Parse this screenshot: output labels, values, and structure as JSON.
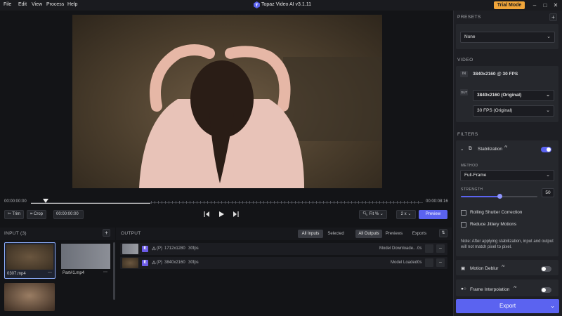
{
  "menu": [
    "File",
    "Edit",
    "View",
    "Process",
    "Help"
  ],
  "app": {
    "title": "Topaz Video AI  v3.1.11",
    "trial_label": "Trial Mode"
  },
  "timeline": {
    "start": "00:00:00:00",
    "end": "00:00:08:16",
    "time_field": "00:00:00:00"
  },
  "toolbar": {
    "trim": "Trim",
    "crop": "Crop",
    "fit": "Fit %",
    "speed": "2 x",
    "preview": "Preview"
  },
  "input": {
    "header": "INPUT (3)",
    "files": [
      {
        "name": "0307.mp4"
      },
      {
        "name": "Part#1.mp4"
      },
      {
        "name": ""
      }
    ]
  },
  "output": {
    "header": "OUTPUT",
    "tabs": [
      "All Inputs",
      "Selected"
    ],
    "tabs2": [
      "All Outputs",
      "Previews",
      "Exports"
    ],
    "rows": [
      {
        "badge": "E",
        "mode": "(P)",
        "res": "1712x1280",
        "fps": "30fps",
        "status": "Model Downloade...",
        "time": "0s"
      },
      {
        "badge": "E",
        "mode": "(P)",
        "res": "3840x2160",
        "fps": "30fps",
        "status": "Model Loaded",
        "time": "0s"
      }
    ]
  },
  "right": {
    "presets_label": "PRESETS",
    "preset_value": "None",
    "video_label": "VIDEO",
    "in_tag": "IN",
    "out_tag": "OUT",
    "in_value": "3840x2160 @ 30 FPS",
    "out_res": "3840x2160 (Original)",
    "out_fps": "30 FPS (Original)",
    "filters_label": "FILTERS",
    "stabilization": "Stabilization",
    "ai_tag": "AI",
    "method_label": "METHOD",
    "method_value": "Full-Frame",
    "strength_label": "STRENGTH",
    "strength_value": "50",
    "strength_fraction": 0.5,
    "rolling_shutter": "Rolling Shutter Correction",
    "reduce_jitter": "Reduce Jittery Motions",
    "note": "Note: After applying stabilization, input and output will not match pixel to pixel.",
    "motion_deblur": "Motion Deblur",
    "frame_interp": "Frame Interpolation",
    "export": "Export"
  },
  "colors": {
    "accent": "#5b63f0",
    "trial": "#f0a53a",
    "badge": "#6c5ce7"
  }
}
